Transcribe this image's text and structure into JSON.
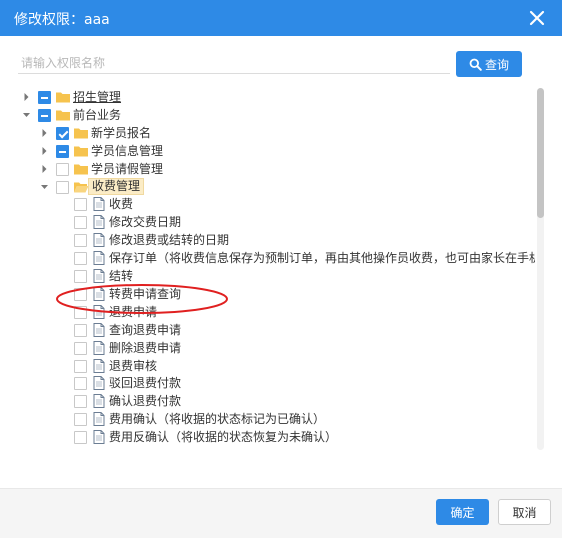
{
  "dialog": {
    "title": "修改权限：aaa",
    "close_icon": "close-icon"
  },
  "search": {
    "placeholder": "请输入权限名称",
    "button_label": "查询",
    "button_icon": "search-icon"
  },
  "tree": {
    "nodes": [
      {
        "label": "招生管理",
        "depth": 0,
        "caret": "collapsed",
        "check": "partial",
        "icon": "folder-icon",
        "underline": true
      },
      {
        "label": "前台业务",
        "depth": 0,
        "caret": "expanded",
        "check": "partial",
        "icon": "folder-icon"
      },
      {
        "label": "新学员报名",
        "depth": 1,
        "caret": "collapsed",
        "check": "checked",
        "icon": "folder-icon"
      },
      {
        "label": "学员信息管理",
        "depth": 1,
        "caret": "collapsed",
        "check": "partial",
        "icon": "folder-icon"
      },
      {
        "label": "学员请假管理",
        "depth": 1,
        "caret": "collapsed",
        "check": "unchecked",
        "icon": "folder-icon"
      },
      {
        "label": "收费管理",
        "depth": 1,
        "caret": "expanded",
        "check": "unchecked",
        "icon": "folder-open-icon",
        "selected": true
      },
      {
        "label": "收费",
        "depth": 2,
        "check": "unchecked",
        "icon": "file-icon"
      },
      {
        "label": "修改交费日期",
        "depth": 2,
        "check": "unchecked",
        "icon": "file-icon"
      },
      {
        "label": "修改退费或结转的日期",
        "depth": 2,
        "check": "unchecked",
        "icon": "file-icon"
      },
      {
        "label": "保存订单（将收费信息保存为预制订单，再由其他操作员收费，也可由家长在手机上",
        "depth": 2,
        "check": "unchecked",
        "icon": "file-icon"
      },
      {
        "label": "结转",
        "depth": 2,
        "check": "unchecked",
        "icon": "file-icon"
      },
      {
        "label": "转费申请查询",
        "depth": 2,
        "check": "unchecked",
        "icon": "file-icon"
      },
      {
        "label": "退费申请",
        "depth": 2,
        "check": "unchecked",
        "icon": "file-icon"
      },
      {
        "label": "查询退费申请",
        "depth": 2,
        "check": "unchecked",
        "icon": "file-icon"
      },
      {
        "label": "删除退费申请",
        "depth": 2,
        "check": "unchecked",
        "icon": "file-icon"
      },
      {
        "label": "退费审核",
        "depth": 2,
        "check": "unchecked",
        "icon": "file-icon"
      },
      {
        "label": "驳回退费付款",
        "depth": 2,
        "check": "unchecked",
        "icon": "file-icon"
      },
      {
        "label": "确认退费付款",
        "depth": 2,
        "check": "unchecked",
        "icon": "file-icon"
      },
      {
        "label": "费用确认（将收据的状态标记为已确认）",
        "depth": 2,
        "check": "unchecked",
        "icon": "file-icon"
      },
      {
        "label": "费用反确认（将收据的状态恢复为未确认）",
        "depth": 2,
        "check": "unchecked",
        "icon": "file-icon"
      }
    ]
  },
  "annotation": {
    "color": "#e02020",
    "target_label": "转费申请查询"
  },
  "footer": {
    "ok_label": "确定",
    "cancel_label": "取消"
  },
  "colors": {
    "accent": "#2e8ae6",
    "folder": "#f6c34e",
    "title_text": "#ffffff"
  }
}
